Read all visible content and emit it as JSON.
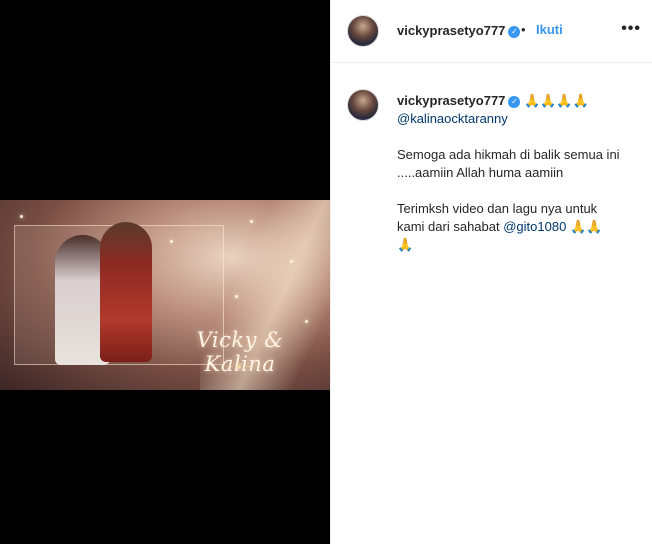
{
  "post": {
    "username": "vickyprasetyo777",
    "follow_label": "Ikuti",
    "separator": "•",
    "more_label": "•••"
  },
  "media": {
    "title_text": "Vicky & Kalina",
    "ornament": "~❦~"
  },
  "caption": {
    "username": "vickyprasetyo777",
    "emojis_1": "🙏🙏🙏🙏",
    "mention_1": "@kalinaocktaranny",
    "line_1": "Semoga ada hikmah di balik semua ini",
    "line_2": ".....aamiin Allah huma aamiin",
    "line_3a": "Terimksh video dan lagu nya untuk",
    "line_3b": "kami dari sahabat ",
    "mention_2": "@gito1080",
    "emojis_2": "🙏🙏",
    "emojis_3": "🙏"
  },
  "colors": {
    "accent_blue": "#3897f0",
    "mention_blue": "#00376b",
    "text": "#262626",
    "divider": "#efefef"
  },
  "icons": {
    "verified": "verified-badge-icon",
    "more": "more-options-icon"
  }
}
